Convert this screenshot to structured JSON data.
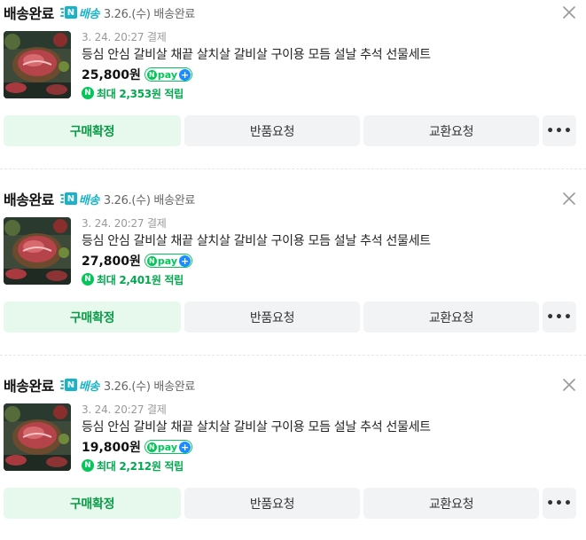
{
  "orders": [
    {
      "status": "배송완료",
      "n_box": "N",
      "delivery_label": "배송",
      "arrival": "3.26.(수) 배송완료",
      "order_date": "3. 24. 20:27 결제",
      "product_name": "등심 안심 갈비살 채끝 살치살 갈비살 구이용 모듬 설날 추석 선물세트",
      "price": "25,800원",
      "npay_n": "N",
      "npay_text": "pay",
      "npay_plus": "+",
      "points_icon": "N",
      "points": "최대 2,353원 적립",
      "buttons": {
        "confirm": "구매확정",
        "return": "반품요청",
        "exchange": "교환요청",
        "more": "•••"
      }
    },
    {
      "status": "배송완료",
      "n_box": "N",
      "delivery_label": "배송",
      "arrival": "3.26.(수) 배송완료",
      "order_date": "3. 24. 20:27 결제",
      "product_name": "등심 안심 갈비살 채끝 살치살 갈비살 구이용 모듬 설날 추석 선물세트",
      "price": "27,800원",
      "npay_n": "N",
      "npay_text": "pay",
      "npay_plus": "+",
      "points_icon": "N",
      "points": "최대 2,401원 적립",
      "buttons": {
        "confirm": "구매확정",
        "return": "반품요청",
        "exchange": "교환요청",
        "more": "•••"
      }
    },
    {
      "status": "배송완료",
      "n_box": "N",
      "delivery_label": "배송",
      "arrival": "3.26.(수) 배송완료",
      "order_date": "3. 24. 20:27 결제",
      "product_name": "등심 안심 갈비살 채끝 살치살 갈비살 구이용 모듬 설날 추석 선물세트",
      "price": "19,800원",
      "npay_n": "N",
      "npay_text": "pay",
      "npay_plus": "+",
      "points_icon": "N",
      "points": "최대 2,212원 적립",
      "buttons": {
        "confirm": "구매확정",
        "return": "반품요청",
        "exchange": "교환요청",
        "more": "•••"
      }
    }
  ],
  "icons": {
    "close": "close-icon",
    "thumbnail": "meat-gift-set-image"
  },
  "colors": {
    "naver_green": "#03c75a",
    "delivery_teal": "#19b3c9",
    "npay_plus_blue": "#1a8cff",
    "confirm_bg": "#e7f9ed"
  }
}
